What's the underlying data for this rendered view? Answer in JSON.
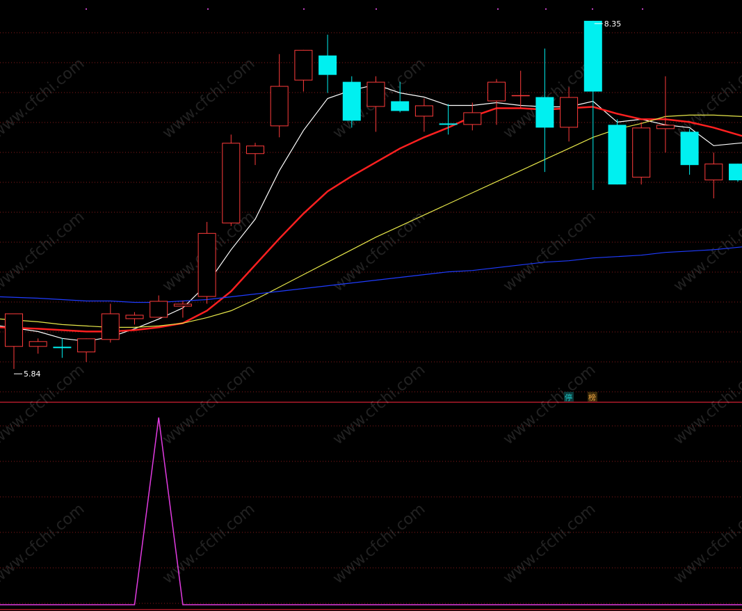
{
  "chart_data": {
    "type": "candlestick",
    "price_panel": {
      "ylim": [
        5.6,
        8.5
      ],
      "high_label": "8.35",
      "low_label": "5.84",
      "candles": [
        {
          "o": 6.0,
          "h": 6.16,
          "l": 5.84,
          "c": 6.24
        },
        {
          "o": 6.0,
          "h": 6.06,
          "l": 5.95,
          "c": 6.04
        },
        {
          "o": 6.0,
          "h": 6.06,
          "l": 5.92,
          "c": 5.99
        },
        {
          "o": 5.96,
          "h": 6.06,
          "l": 5.89,
          "c": 6.06
        },
        {
          "o": 6.05,
          "h": 6.31,
          "l": 6.03,
          "c": 6.24
        },
        {
          "o": 6.2,
          "h": 6.25,
          "l": 6.16,
          "c": 6.23
        },
        {
          "o": 6.21,
          "h": 6.37,
          "l": 6.21,
          "c": 6.33
        },
        {
          "o": 6.29,
          "h": 6.33,
          "l": 6.21,
          "c": 6.31
        },
        {
          "o": 6.36,
          "h": 6.9,
          "l": 6.31,
          "c": 6.82
        },
        {
          "o": 6.89,
          "h": 7.53,
          "l": 6.87,
          "c": 7.47
        },
        {
          "o": 7.39,
          "h": 7.47,
          "l": 7.31,
          "c": 7.45
        },
        {
          "o": 7.59,
          "h": 8.11,
          "l": 7.51,
          "c": 7.88
        },
        {
          "o": 7.92,
          "h": 8.14,
          "l": 7.84,
          "c": 8.14
        },
        {
          "o": 8.1,
          "h": 8.25,
          "l": 7.83,
          "c": 7.96
        },
        {
          "o": 7.91,
          "h": 7.95,
          "l": 7.58,
          "c": 7.63
        },
        {
          "o": 7.73,
          "h": 7.95,
          "l": 7.55,
          "c": 7.91
        },
        {
          "o": 7.77,
          "h": 7.91,
          "l": 7.69,
          "c": 7.7
        },
        {
          "o": 7.66,
          "h": 7.79,
          "l": 7.55,
          "c": 7.74
        },
        {
          "o": 7.61,
          "h": 7.75,
          "l": 7.53,
          "c": 7.6
        },
        {
          "o": 7.6,
          "h": 7.76,
          "l": 7.56,
          "c": 7.69
        },
        {
          "o": 7.77,
          "h": 7.93,
          "l": 7.6,
          "c": 7.91
        },
        {
          "o": 7.81,
          "h": 7.99,
          "l": 7.72,
          "c": 7.81
        },
        {
          "o": 7.8,
          "h": 8.15,
          "l": 7.26,
          "c": 7.58
        },
        {
          "o": 7.58,
          "h": 7.87,
          "l": 7.48,
          "c": 7.8
        },
        {
          "o": 8.35,
          "h": 8.35,
          "l": 7.13,
          "c": 7.84
        },
        {
          "o": 7.6,
          "h": 7.64,
          "l": 7.17,
          "c": 7.17
        },
        {
          "o": 7.22,
          "h": 7.62,
          "l": 7.17,
          "c": 7.58
        },
        {
          "o": 7.57,
          "h": 7.95,
          "l": 7.4,
          "c": 7.6
        },
        {
          "o": 7.55,
          "h": 7.57,
          "l": 7.24,
          "c": 7.31
        },
        {
          "o": 7.2,
          "h": 7.4,
          "l": 7.07,
          "c": 7.32
        },
        {
          "o": 7.32,
          "h": 7.32,
          "l": 7.19,
          "c": 7.2
        }
      ],
      "ma_lines": [
        {
          "color": "#ffffff",
          "values": [
            6.15,
            6.11,
            6.06,
            6.04,
            6.07,
            6.13,
            6.2,
            6.28,
            6.45,
            6.7,
            6.92,
            7.27,
            7.56,
            7.79,
            7.85,
            7.89,
            7.83,
            7.8,
            7.74,
            7.74,
            7.76,
            7.74,
            7.73,
            7.73,
            7.77,
            7.62,
            7.64,
            7.6,
            7.58,
            7.45,
            7.47
          ]
        },
        {
          "color": "#ff2020",
          "values": [
            6.14,
            6.13,
            6.12,
            6.11,
            6.11,
            6.12,
            6.14,
            6.17,
            6.26,
            6.4,
            6.59,
            6.78,
            6.96,
            7.12,
            7.23,
            7.33,
            7.43,
            7.51,
            7.58,
            7.66,
            7.72,
            7.72,
            7.71,
            7.72,
            7.73,
            7.68,
            7.64,
            7.64,
            7.62,
            7.58,
            7.52
          ]
        },
        {
          "color": "#e8e84a",
          "values": [
            6.2,
            6.18,
            6.16,
            6.15,
            6.14,
            6.14,
            6.15,
            6.17,
            6.21,
            6.26,
            6.34,
            6.43,
            6.52,
            6.61,
            6.7,
            6.79,
            6.87,
            6.95,
            7.03,
            7.11,
            7.19,
            7.27,
            7.35,
            7.43,
            7.51,
            7.57,
            7.61,
            7.66,
            7.67,
            7.67,
            7.66
          ]
        },
        {
          "color": "#1f3cff",
          "values": [
            6.36,
            6.35,
            6.34,
            6.33,
            6.33,
            6.32,
            6.32,
            6.33,
            6.34,
            6.36,
            6.38,
            6.4,
            6.42,
            6.44,
            6.46,
            6.48,
            6.5,
            6.52,
            6.54,
            6.55,
            6.57,
            6.59,
            6.61,
            6.62,
            6.64,
            6.65,
            6.66,
            6.68,
            6.69,
            6.7,
            6.72
          ]
        }
      ]
    },
    "indicator_panel": {
      "color": "#e23be2",
      "ylim": [
        0,
        1
      ],
      "values": [
        0,
        0,
        0,
        0,
        0,
        0,
        1,
        0,
        0,
        0,
        0,
        0,
        0,
        0,
        0,
        0,
        0,
        0,
        0,
        0,
        0,
        0,
        0,
        0,
        0,
        0,
        0,
        0,
        0,
        0,
        0
      ]
    },
    "badges": [
      {
        "text": "停",
        "color": "#20c8c8"
      },
      {
        "text": "榜",
        "color": "#e8a040"
      }
    ],
    "colors": {
      "up": "#ff3b3b",
      "down": "#00f0f0",
      "grid": "#8b1a1a",
      "separator": "#b01a2a",
      "marker": "#c040c0"
    },
    "watermark": "www.cfchi.com"
  }
}
